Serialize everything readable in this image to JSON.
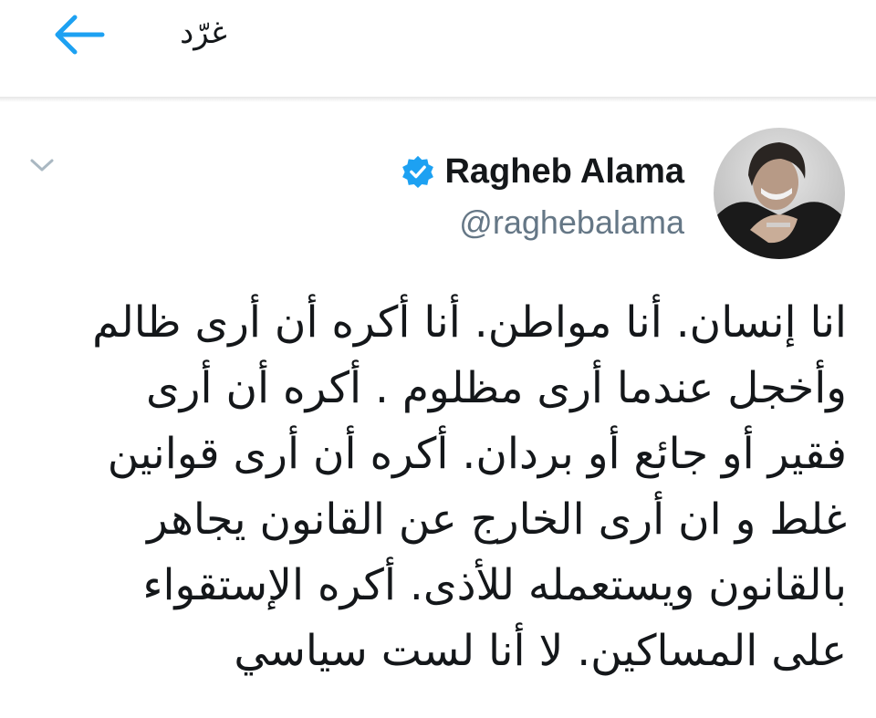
{
  "header": {
    "title": "غرّد"
  },
  "tweet": {
    "author": {
      "display_name": "Ragheb Alama",
      "handle": "@raghebalama",
      "verified": true
    },
    "text_lines": [
      "انا إنسان. أنا مواطن. أنا أكره أن أرى ظالم",
      "وأخجل عندما أرى مظلوم . أكره أن أرى",
      "فقير أو جائع أو بردان. أكره أن أرى قوانين",
      "غلط و ان أرى الخارج عن القانون يجاهر",
      "بالقانون ويستعمله للأذى. أكره الإستقواء",
      "على المساكين. لا أنا لست سياسي"
    ]
  },
  "icons": {
    "back": "arrow-left-icon",
    "caret": "chevron-down-icon",
    "verified": "verified-badge-icon"
  },
  "colors": {
    "accent": "#1da1f2",
    "text": "#14171a",
    "muted": "#657786",
    "caret": "#aab8c2"
  }
}
